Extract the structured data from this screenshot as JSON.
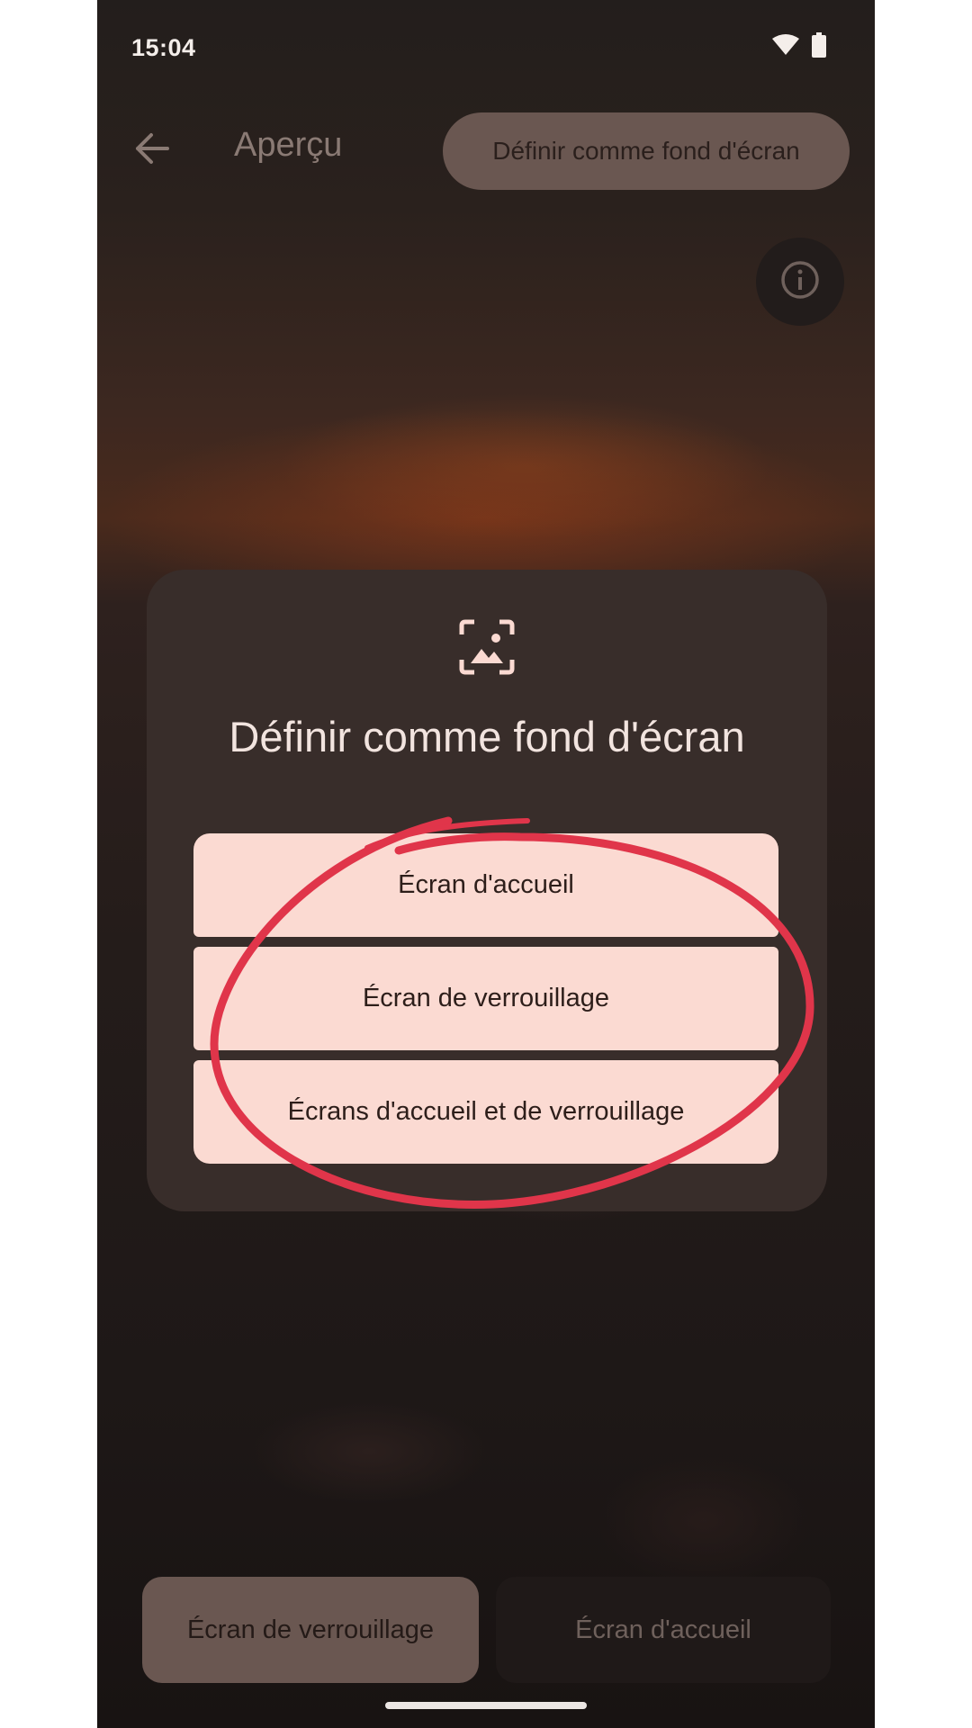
{
  "status_bar": {
    "time": "15:04",
    "icons": [
      "wifi-icon",
      "battery-icon"
    ]
  },
  "top_bar": {
    "back_icon": "arrow-left-icon",
    "title": "Aperçu",
    "set_wallpaper_label": "Définir comme fond d'écran",
    "info_icon": "info-icon"
  },
  "dialog": {
    "icon": "wallpaper-icon",
    "title": "Définir comme fond d'écran",
    "options": [
      {
        "label": "Écran d'accueil"
      },
      {
        "label": "Écran de verrouillage"
      },
      {
        "label": "Écrans d'accueil et de verrouillage"
      }
    ]
  },
  "annotation": {
    "shape": "hand-drawn-circle",
    "color": "#e0354a"
  },
  "bottom_tabs": [
    {
      "label": "Écran de verrouillage",
      "selected": true
    },
    {
      "label": "Écran d'accueil",
      "selected": false
    }
  ],
  "colors": {
    "dialog_bg": "#382d2a",
    "option_bg": "#fbdad2",
    "accent_pill": "#6a5751"
  }
}
